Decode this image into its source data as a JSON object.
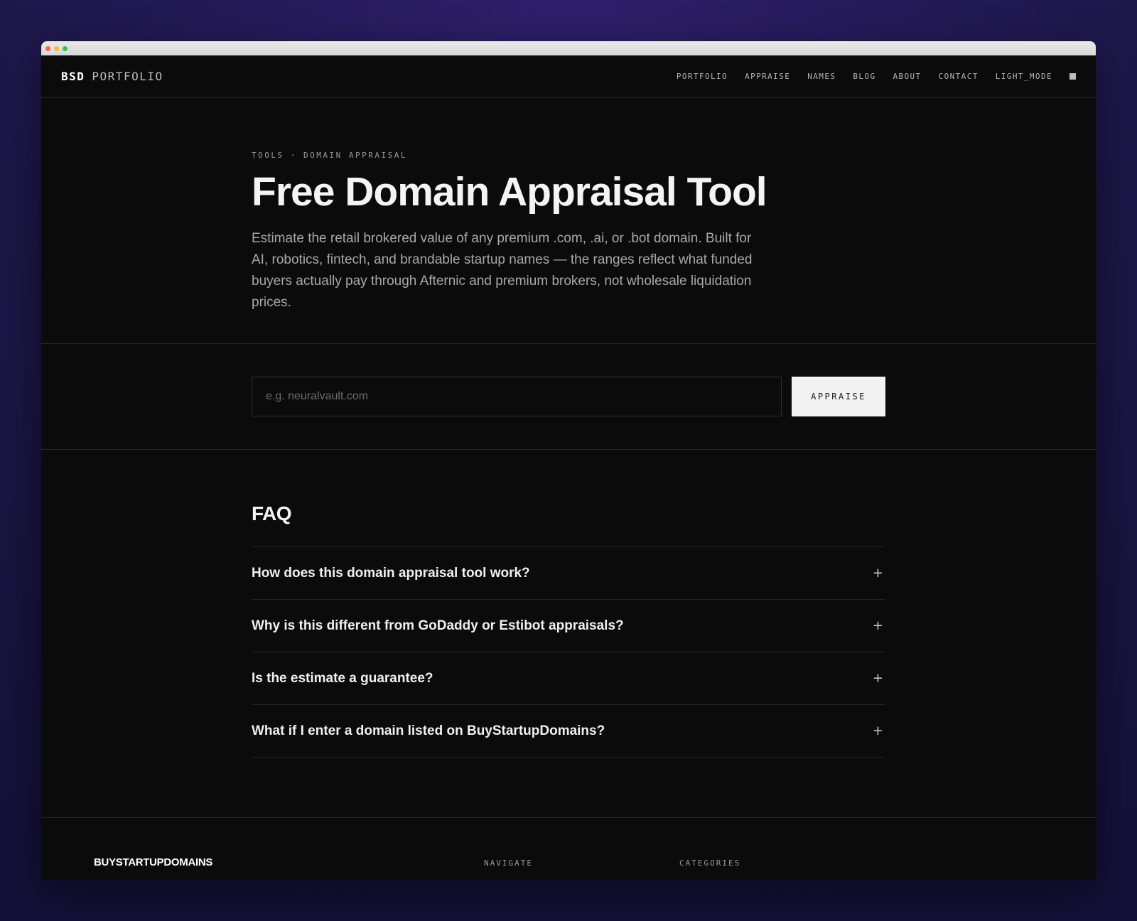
{
  "nav": {
    "brand_primary": "BSD",
    "brand_secondary": "PORTFOLIO",
    "links": [
      "PORTFOLIO",
      "APPRAISE",
      "NAMES",
      "BLOG",
      "ABOUT",
      "CONTACT",
      "LIGHT_MODE"
    ]
  },
  "hero": {
    "breadcrumb": "TOOLS · DOMAIN APPRAISAL",
    "title": "Free Domain Appraisal Tool",
    "description": "Estimate the retail brokered value of any premium .com, .ai, or .bot domain. Built for AI, robotics, fintech, and brandable startup names — the ranges reflect what funded buyers actually pay through Afternic and premium brokers, not wholesale liquidation prices."
  },
  "form": {
    "placeholder": "e.g. neuralvault.com",
    "value": "",
    "button_label": "APPRAISE"
  },
  "faq": {
    "heading": "FAQ",
    "items": [
      {
        "question": "How does this domain appraisal tool work?",
        "toggle": "+"
      },
      {
        "question": "Why is this different from GoDaddy or Estibot appraisals?",
        "toggle": "+"
      },
      {
        "question": "Is the estimate a guarantee?",
        "toggle": "+"
      },
      {
        "question": "What if I enter a domain listed on BuyStartupDomains?",
        "toggle": "+"
      }
    ]
  },
  "footer": {
    "brand": "BUYSTARTUPDOMAINS",
    "columns": [
      "NAVIGATE",
      "CATEGORIES"
    ]
  },
  "icons": {
    "theme_toggle": "square-icon",
    "faq_expand": "plus-icon"
  },
  "colors": {
    "page_background": "#0b0b0b",
    "text_primary": "#f4f4f4",
    "text_muted": "#a9a9a9",
    "button_background": "#f2f2f2",
    "divider": "#262626"
  }
}
